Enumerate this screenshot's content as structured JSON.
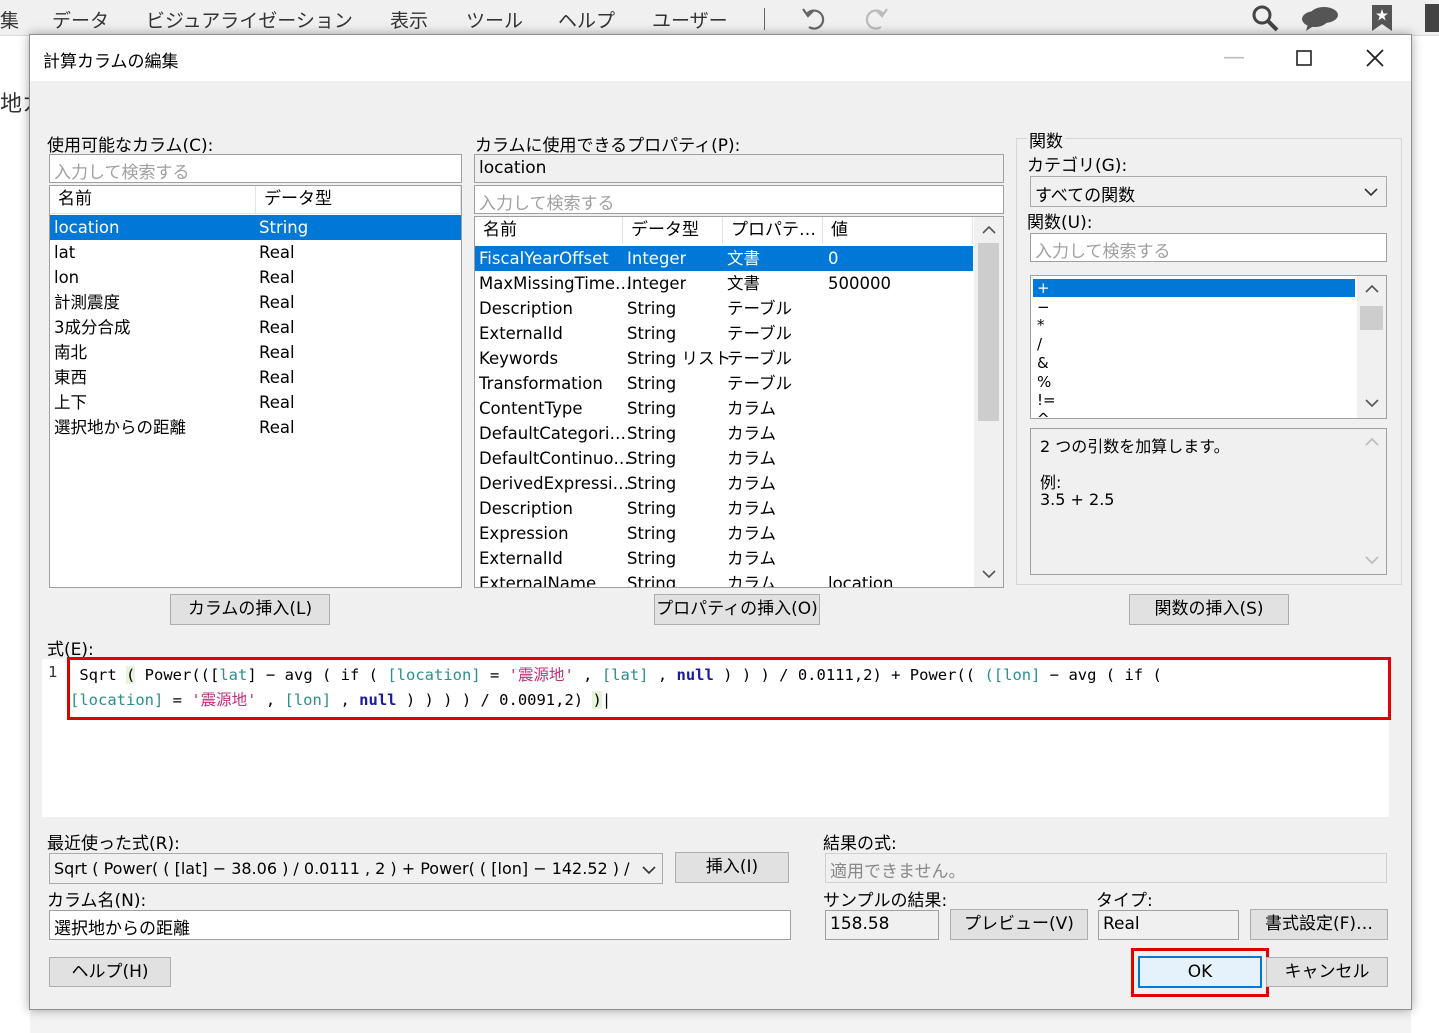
{
  "appbar": {
    "menu": [
      "集",
      "データ",
      "ビジュアライゼーション",
      "表示",
      "ツール",
      "ヘルプ",
      "ユーザー"
    ],
    "left_fragment": "地カ"
  },
  "dialog": {
    "title": "計算カラムの編集",
    "available_columns": {
      "label": "使用可能なカラム(C):",
      "search_placeholder": "入力して検索する",
      "headers": [
        "名前",
        "データ型"
      ],
      "rows": [
        [
          "location",
          "String"
        ],
        [
          "lat",
          "Real"
        ],
        [
          "lon",
          "Real"
        ],
        [
          "計測震度",
          "Real"
        ],
        [
          "3成分合成",
          "Real"
        ],
        [
          "南北",
          "Real"
        ],
        [
          "東西",
          "Real"
        ],
        [
          "上下",
          "Real"
        ],
        [
          "選択地からの距離",
          "Real"
        ]
      ],
      "insert_button": "カラムの挿入(L)"
    },
    "properties": {
      "label": "カラムに使用できるプロパティ(P):",
      "current_column": "location",
      "search_placeholder": "入力して検索する",
      "headers": [
        "名前",
        "データ型",
        "プロパテ…",
        "値"
      ],
      "rows": [
        [
          "FiscalYearOffset",
          "Integer",
          "文書",
          "0"
        ],
        [
          "MaxMissingTime…",
          "Integer",
          "文書",
          "500000"
        ],
        [
          "Description",
          "String",
          "テーブル",
          ""
        ],
        [
          "ExternalId",
          "String",
          "テーブル",
          ""
        ],
        [
          "Keywords",
          "String リスト",
          "テーブル",
          ""
        ],
        [
          "Transformation",
          "String",
          "テーブル",
          ""
        ],
        [
          "ContentType",
          "String",
          "カラム",
          ""
        ],
        [
          "DefaultCategori…",
          "String",
          "カラム",
          ""
        ],
        [
          "DefaultContinuo…",
          "String",
          "カラム",
          ""
        ],
        [
          "DerivedExpressi…",
          "String",
          "カラム",
          ""
        ],
        [
          "Description",
          "String",
          "カラム",
          ""
        ],
        [
          "Expression",
          "String",
          "カラム",
          ""
        ],
        [
          "ExternalId",
          "String",
          "カラム",
          ""
        ],
        [
          "ExternalName",
          "String",
          "カラム",
          "location"
        ]
      ],
      "insert_button": "プロパティの挿入(O)"
    },
    "functions": {
      "group_label": "関数",
      "category_label": "カテゴリ(G):",
      "category_value": "すべての関数",
      "function_label": "関数(U):",
      "search_placeholder": "入力して検索する",
      "items": [
        "+",
        "−",
        "*",
        "/",
        "&",
        "%",
        "!=",
        "^"
      ],
      "description_line1": "2 つの引数を加算します。",
      "description_line2": "例:",
      "description_line3": "3.5 + 2.5",
      "insert_button": "関数の挿入(S)"
    },
    "expression": {
      "label": "式(E):",
      "line_number": "1"
    },
    "recent": {
      "label": "最近使った式(R):",
      "value": "Sqrt ( Power( ( [lat] − 38.06 ) / 0.0111 , 2 ) + Power( ( [lon] − 142.52 ) /",
      "insert_button": "挿入(I)"
    },
    "column_name": {
      "label": "カラム名(N):",
      "value": "選択地からの距離"
    },
    "result": {
      "label": "結果の式:",
      "value": "適用できません。",
      "sample_label": "サンプルの結果:",
      "sample_value": "158.58",
      "preview_button": "プレビュー(V)",
      "type_label": "タイプ:",
      "type_value": "Real",
      "format_button": "書式設定(F)…"
    },
    "help_button": "ヘルプ(H)",
    "ok_button": "OK",
    "cancel_button": "キャンセル"
  },
  "colors": {
    "selection": "#0078d7",
    "highlight_border": "#e00000",
    "keyword": "#1a1aa6",
    "column_ref": "#2b8f8f",
    "string": "#c0307a"
  }
}
